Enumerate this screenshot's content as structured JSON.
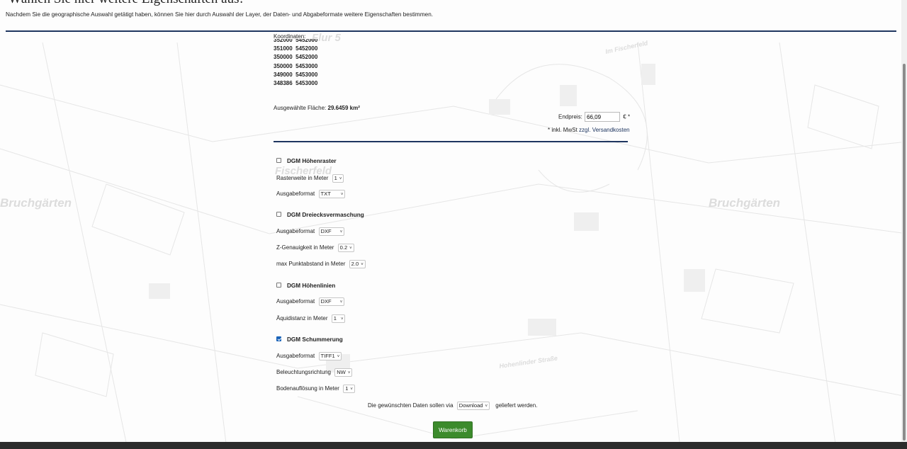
{
  "header": {
    "title": "Wählen Sie hier weitere Eigenschaften aus!",
    "intro": "Nachdem Sie die geographische Auswahl getätigt haben, können Sie hier durch Auswahl der Layer, der Daten- und Abgabeformate weitere Eigenschaften bestimmen."
  },
  "map_labels": {
    "left": "Bruchgärten",
    "right": "Bruchgärten",
    "flur": "Flur 5",
    "fischerfeld": "Fischerfeld",
    "im_fischerfeld": "Im Fischerfeld",
    "street": "Hohenlinder Straße"
  },
  "coordinates": {
    "label": "Koordinaten:",
    "items": [
      "352000  5452000",
      "351000  5452000",
      "350000  5452000",
      "350000  5453000",
      "349000  5453000",
      "348386  5453000"
    ]
  },
  "area": {
    "label": "Ausgewählte Fläche:",
    "value": "29.6459 km²"
  },
  "price": {
    "label": "Endpreis:",
    "value": "66,09",
    "currency": "€ *",
    "vat_note": "* inkl. MwSt",
    "shipping_link": "zzgl. Versandkosten"
  },
  "products": [
    {
      "title": "DGM Höhenraster",
      "checked": false,
      "options": [
        {
          "label": "Rasterweite in Meter",
          "value": "1"
        },
        {
          "label": "Ausgabeformat",
          "value": "TXT"
        }
      ]
    },
    {
      "title": "DGM Dreiecksvermaschung",
      "checked": false,
      "options": [
        {
          "label": "Ausgabeformat",
          "value": "DXF"
        },
        {
          "label": "Z-Genauigkeit in Meter",
          "value": "0.2"
        },
        {
          "label": "max Punktabstand in Meter",
          "value": "2.0"
        }
      ]
    },
    {
      "title": "DGM Höhenlinien",
      "checked": false,
      "options": [
        {
          "label": "Ausgabeformat",
          "value": "DXF"
        },
        {
          "label": "Äquidistanz in Meter",
          "value": "1"
        }
      ]
    },
    {
      "title": "DGM Schummerung",
      "checked": true,
      "options": [
        {
          "label": "Ausgabeformat",
          "value": "TIFF1"
        },
        {
          "label": "Beleuchtungsrichtung",
          "value": "NW"
        },
        {
          "label": "Bodenauflösung in Meter",
          "value": "1"
        }
      ]
    }
  ],
  "delivery": {
    "prefix": "Die gewünschten Daten sollen via",
    "value": "Download",
    "suffix": "geliefert werden."
  },
  "cart_button": "Warenkorb",
  "colors": {
    "rule": "#1f3660",
    "cart_button": "#3c8b2c",
    "checkbox_checked": "#1a63b8"
  }
}
